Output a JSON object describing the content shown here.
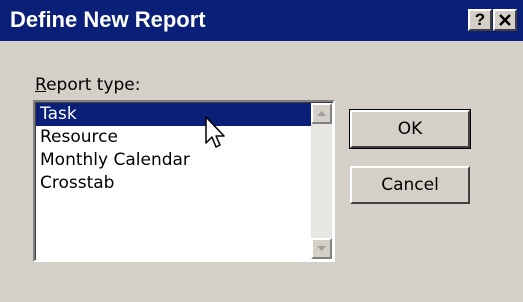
{
  "window": {
    "title": "Define New Report",
    "help_label": "?"
  },
  "report_type": {
    "label_underlined": "R",
    "label_rest": "eport type:",
    "items": [
      {
        "label": "Task",
        "selected": true
      },
      {
        "label": "Resource",
        "selected": false
      },
      {
        "label": "Monthly Calendar",
        "selected": false
      },
      {
        "label": "Crosstab",
        "selected": false
      }
    ]
  },
  "buttons": {
    "ok_label": "OK",
    "cancel_label": "Cancel"
  },
  "icons": {
    "close": "close-icon",
    "scroll_up": "arrow-up-icon",
    "scroll_down": "arrow-down-icon",
    "cursor": "mouse-pointer-icon"
  },
  "colors": {
    "titlebar": "#0a2078",
    "selection": "#0a2078",
    "dialog_face": "#d4d0c8"
  }
}
